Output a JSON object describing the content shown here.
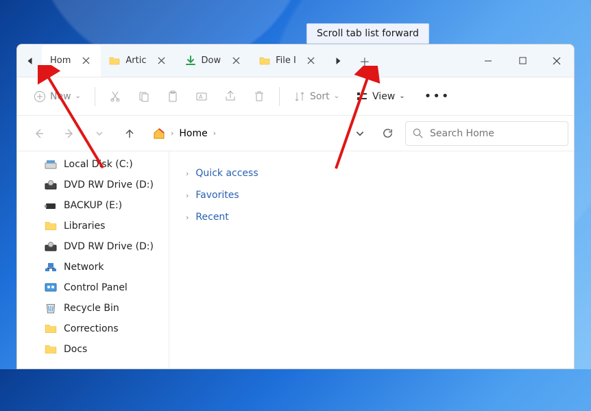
{
  "tooltip": "Scroll tab list forward",
  "tabs": [
    {
      "id": "home",
      "label": "Hom",
      "iconColor": "#d62d20",
      "active": true
    },
    {
      "id": "artic",
      "label": "Artic",
      "icon": "folder"
    },
    {
      "id": "downloads",
      "label": "Dow",
      "icon": "download"
    },
    {
      "id": "file",
      "label": "File I",
      "icon": "folder"
    }
  ],
  "toolbar": {
    "new": "New",
    "sort": "Sort",
    "view": "View"
  },
  "breadcrumb": {
    "root": "Home"
  },
  "search": {
    "placeholder": "Search Home"
  },
  "sidebar": [
    {
      "label": "Local Disk (C:)",
      "icon": "disk"
    },
    {
      "label": "DVD RW Drive (D:)",
      "icon": "dvd"
    },
    {
      "label": "BACKUP (E:)",
      "icon": "usb"
    },
    {
      "label": "Libraries",
      "icon": "folder"
    },
    {
      "label": "DVD RW Drive (D:)",
      "icon": "dvd"
    },
    {
      "label": "Network",
      "icon": "network"
    },
    {
      "label": "Control Panel",
      "icon": "control"
    },
    {
      "label": "Recycle Bin",
      "icon": "recycle"
    },
    {
      "label": "Corrections",
      "icon": "folder"
    },
    {
      "label": "Docs",
      "icon": "folder"
    }
  ],
  "main_sections": [
    {
      "label": "Quick access"
    },
    {
      "label": "Favorites"
    },
    {
      "label": "Recent"
    }
  ]
}
